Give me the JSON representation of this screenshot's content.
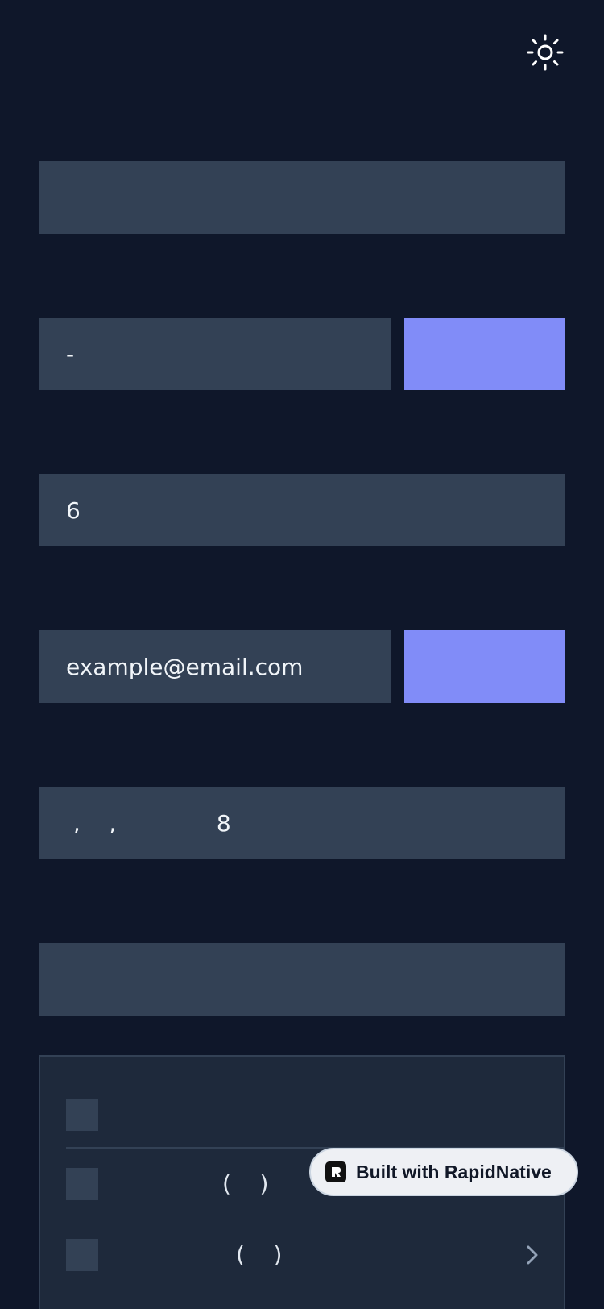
{
  "header": {
    "theme_icon": "sun-icon"
  },
  "fields": {
    "field_1": "",
    "field_2": "-",
    "field_3": "6",
    "field_4": "example@email.com",
    "field_5": " ,    ,              8",
    "field_6": ""
  },
  "panel": {
    "rows": [
      {
        "label": ""
      },
      {
        "label": "(    )"
      },
      {
        "label": "(    )"
      }
    ],
    "chevron_icon": "chevron-right-icon"
  },
  "badge": {
    "label": "Built with RapidNative",
    "logo_icon": "rapidnative-logo"
  },
  "colors": {
    "background": "#0f172a",
    "field": "#334155",
    "accent": "#818cf8",
    "panel": "#1e293b",
    "badge": "#eef0f4"
  }
}
